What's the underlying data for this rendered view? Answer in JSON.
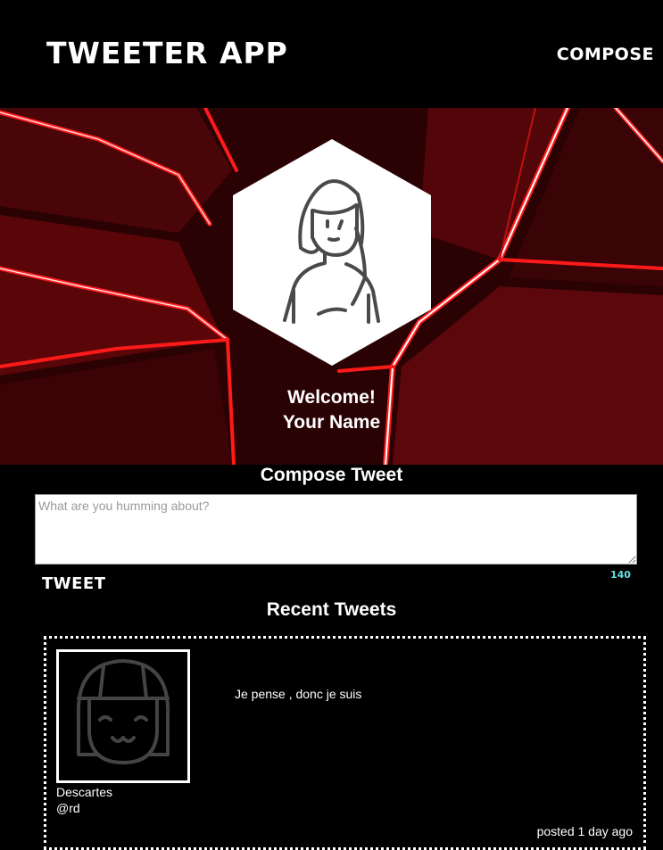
{
  "nav": {
    "brand": "Tweeter App",
    "compose_label": "Compose"
  },
  "profile": {
    "welcome": "Welcome!",
    "name": "Your Name",
    "avatar_icon": "person-avatar-icon"
  },
  "compose": {
    "title": "Compose Tweet",
    "placeholder": "What are you humming about?",
    "submit_label": "Tweet",
    "char_count": "140"
  },
  "feed": {
    "title": "Recent Tweets",
    "tweets": [
      {
        "author": "Descartes",
        "handle": "@rd",
        "content": "Je pense , donc je suis",
        "time": "posted 1 day ago",
        "avatar_icon": "girl-avatar-icon"
      }
    ]
  },
  "colors": {
    "background": "#000000",
    "accent_red": "#ff1a1a",
    "counter": "#5fe0e0",
    "avatar_stroke": "#444444"
  }
}
